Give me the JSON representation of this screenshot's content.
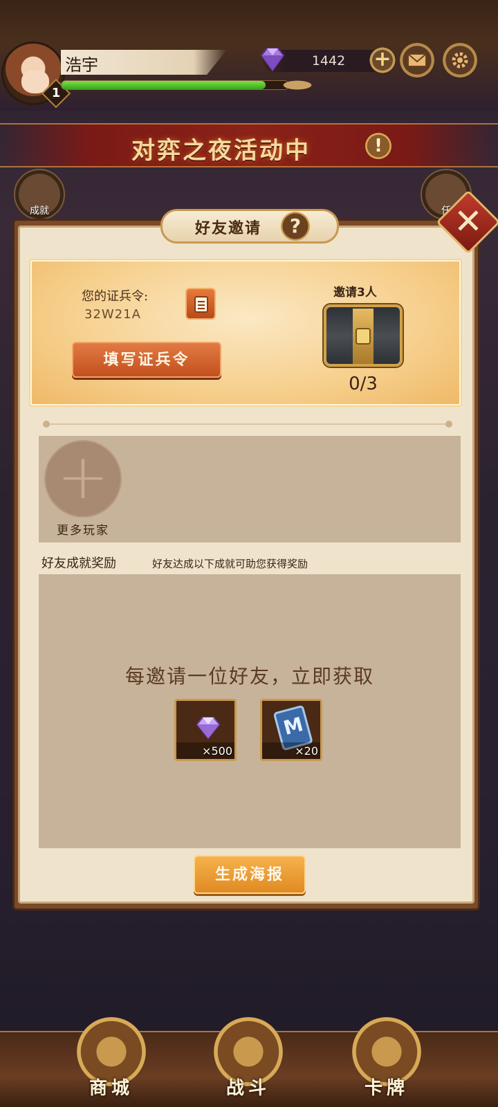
{
  "player": {
    "name": "浩宇",
    "level": "1",
    "exp_progress": 0.9
  },
  "currency": {
    "gems": "1442"
  },
  "event": {
    "banner_text": "对弈之夜活动中",
    "alert_symbol": "!"
  },
  "side_icons": {
    "left_label": "成就",
    "right_label": "任"
  },
  "panel": {
    "title": "好友邀请",
    "help_symbol": "?",
    "close_symbol": "✕",
    "invite": {
      "code_label": "您的证兵令:",
      "code_value": "32W21A",
      "fill_button": "填写证兵令",
      "goal_label": "邀请3人",
      "progress": "0/3"
    },
    "friends": {
      "add_label": "更多玩家"
    },
    "achievements": {
      "title": "好友成就奖励",
      "subtitle": "好友达成以下成就可助您获得奖励"
    },
    "rewards": {
      "headline": "每邀请一位好友，立即获取",
      "items": [
        {
          "icon": "gem-icon",
          "qty": "×500"
        },
        {
          "icon": "card-m-icon",
          "letter": "M",
          "qty": "×20"
        }
      ]
    },
    "poster_button": "生成海报"
  },
  "bottom_nav": [
    {
      "label": "商城",
      "icon": "shop-icon"
    },
    {
      "label": "战斗",
      "icon": "battle-icon"
    },
    {
      "label": "卡牌",
      "icon": "cards-icon"
    }
  ],
  "colors": {
    "accent_orange": "#e08a22",
    "panel_bg": "#efe3cc",
    "exp_green": "#3aa41c"
  }
}
